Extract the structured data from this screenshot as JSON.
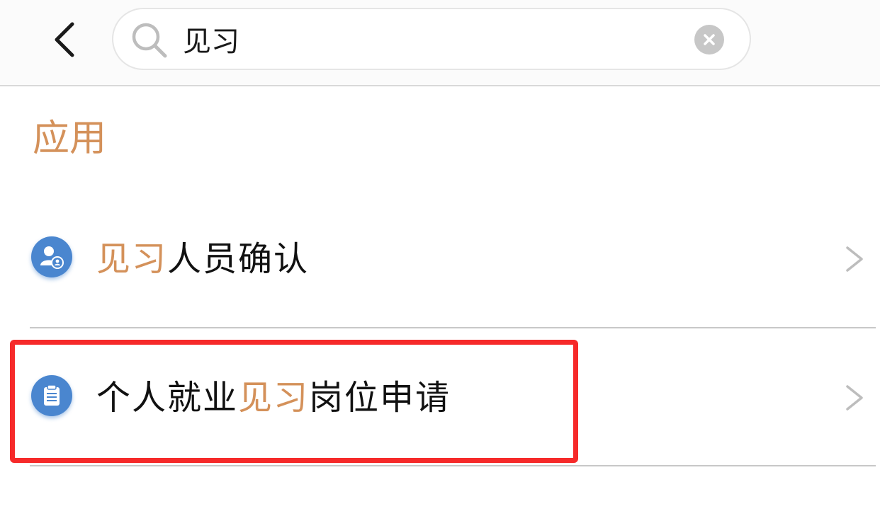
{
  "header": {
    "back_icon": "chevron-left-icon",
    "search": {
      "value": "见习",
      "placeholder": "",
      "search_icon": "search-icon",
      "clear_icon": "close-circle-icon"
    }
  },
  "section": {
    "title": "应用"
  },
  "results": [
    {
      "icon": "person-badge-icon",
      "label_parts": [
        {
          "text": "见习",
          "highlight": true
        },
        {
          "text": "人员确认",
          "highlight": false
        }
      ],
      "chevron_icon": "chevron-right-icon"
    },
    {
      "icon": "clipboard-icon",
      "label_parts": [
        {
          "text": "个人就业",
          "highlight": false
        },
        {
          "text": "见习",
          "highlight": true
        },
        {
          "text": "岗位申请",
          "highlight": false
        }
      ],
      "chevron_icon": "chevron-right-icon"
    }
  ],
  "colors": {
    "accent": "#d4915a",
    "icon_blue": "#4a86cf",
    "annotation_red": "#f62a2a"
  }
}
